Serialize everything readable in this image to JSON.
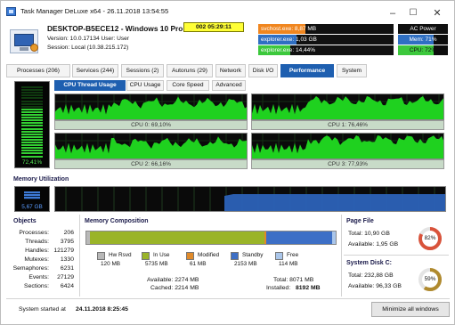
{
  "window": {
    "title": "Task Manager DeLuxe x64 - 26.11.2018 13:54:55"
  },
  "header": {
    "computer": "DESKTOP-B5ECE12 - Windows 10 Pro x64",
    "version": "Version: 10.0.17134   User: User",
    "session": "Session: Local (10.38.215.172)",
    "uptime": "002 05:29:11"
  },
  "top_processes": [
    {
      "label": "svchost.exe: 8,87 MB",
      "color": "#f0861f",
      "fill": 0.35
    },
    {
      "label": "explorer.exe: 1,03 GB",
      "color": "#2f6fc2",
      "fill": 0.28
    },
    {
      "label": "explorer.exe: 14,44%",
      "color": "#3cc83c",
      "fill": 0.24
    }
  ],
  "status": {
    "power": "AC Power",
    "mem": "Mem: 71%",
    "mem_fill": 0.71,
    "cpu": "CPU: 72%",
    "cpu_fill": 0.72
  },
  "tabs": [
    "Processes (206)",
    "Services (244)",
    "Sessions (2)",
    "Autoruns (29)",
    "Network",
    "Disk I/O",
    "Performance",
    "System"
  ],
  "subtabs": [
    "CPU Thread Usage",
    "CPU Usage",
    "Core Speed",
    "Advanced"
  ],
  "cpu_total": "72,41%",
  "cpu_captions": [
    "CPU 0: 69,10%",
    "CPU 1: 76,46%",
    "CPU 2: 66,16%",
    "CPU 3: 77,93%"
  ],
  "memory": {
    "title": "Memory Utilization",
    "value": "5,67 GB"
  },
  "objects": {
    "title": "Objects",
    "rows": [
      {
        "label": "Processes:",
        "value": "206"
      },
      {
        "label": "Threads:",
        "value": "3795"
      },
      {
        "label": "Handles:",
        "value": "121279"
      },
      {
        "label": "Mutexes:",
        "value": "1330"
      },
      {
        "label": "Semaphores:",
        "value": "6231"
      },
      {
        "label": "Events:",
        "value": "27129"
      },
      {
        "label": "Sections:",
        "value": "6424"
      }
    ]
  },
  "composition": {
    "title": "Memory Composition",
    "segments": [
      {
        "name": "Hw Rsvd",
        "value": "120 MB",
        "color": "#b8b8b8",
        "mb": 120
      },
      {
        "name": "In Use",
        "value": "5735 MB",
        "color": "#9ab428",
        "mb": 5735
      },
      {
        "name": "Modified",
        "value": "61 MB",
        "color": "#e08a2a",
        "mb": 61
      },
      {
        "name": "Standby",
        "value": "2153 MB",
        "color": "#3d6fc6",
        "mb": 2153
      },
      {
        "name": "Free",
        "value": "114 MB",
        "color": "#aac6ea",
        "mb": 114
      }
    ],
    "available": "Available: 2274 MB",
    "cached": "Cached: 2214 MB",
    "total": "Total: 8071 MB",
    "installed_label": "Installed:",
    "installed_value": "8192 MB"
  },
  "pagefile": {
    "title": "Page File",
    "total": "Total: 10,90 GB",
    "available": "Available: 1,95 GB",
    "percent": "82%",
    "fraction": 0.82,
    "color": "#d9533b"
  },
  "disk": {
    "title": "System Disk C:",
    "total": "Total: 232,88 GB",
    "available": "Available: 96,33 GB",
    "percent": "59%",
    "fraction": 0.59,
    "color": "#b08a2e"
  },
  "footer": {
    "label": "System started at",
    "value": "24.11.2018 8:25:45",
    "button": "Minimize all windows"
  }
}
